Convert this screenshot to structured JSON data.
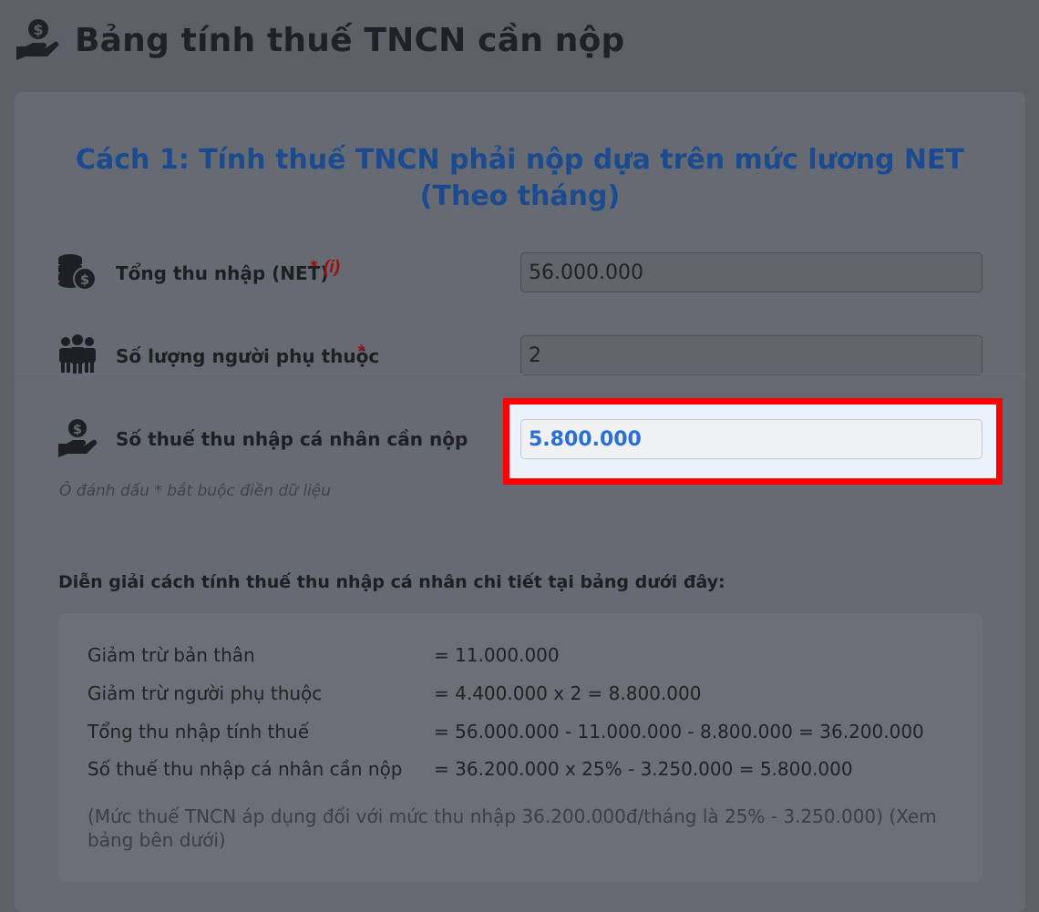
{
  "header": {
    "title": "Bảng tính thuế TNCN cần nộp"
  },
  "card": {
    "title_line1": "Cách 1: Tính thuế TNCN phải nộp dựa trên mức lương NET",
    "title_line2": "(Theo tháng)"
  },
  "form": {
    "net_income": {
      "label": "Tổng thu nhập (NET)",
      "required_mark": "*",
      "info_mark": "(i)",
      "value": "56.000.000"
    },
    "dependents": {
      "label": "Số lượng người phụ thuộc",
      "required_mark": "*",
      "value": "2"
    },
    "tax_due": {
      "label": "Số thuế thu nhập cá nhân cần nộp",
      "value": "5.800.000"
    },
    "note": "Ô đánh dấu * bắt buộc điền dữ liệu"
  },
  "explanation": {
    "heading": "Diễn giải cách tính thuế thu nhập cá nhân chi tiết tại bảng dưới đây:",
    "rows": [
      {
        "label": "Giảm trừ bản thân",
        "value": "= 11.000.000"
      },
      {
        "label": "Giảm trừ người phụ thuộc",
        "value": "= 4.400.000 x 2 = 8.800.000"
      },
      {
        "label": "Tổng thu nhập tính thuế",
        "value": "= 56.000.000 - 11.000.000 - 8.800.000 = 36.200.000"
      },
      {
        "label": "Số thuế thu nhập cá nhân cần nộp",
        "value": "= 36.200.000 x 25% - 3.250.000 = 5.800.000"
      }
    ],
    "footnote": "(Mức thuế TNCN áp dụng đối với mức thu nhập 36.200.000đ/tháng là 25% - 3.250.000) (Xem bảng bên dưới)"
  },
  "colors": {
    "overlay": "#5d6067",
    "title_blue": "#1c4a8f",
    "highlight_red": "#ff0000",
    "result_blue": "#2a6fd8"
  }
}
